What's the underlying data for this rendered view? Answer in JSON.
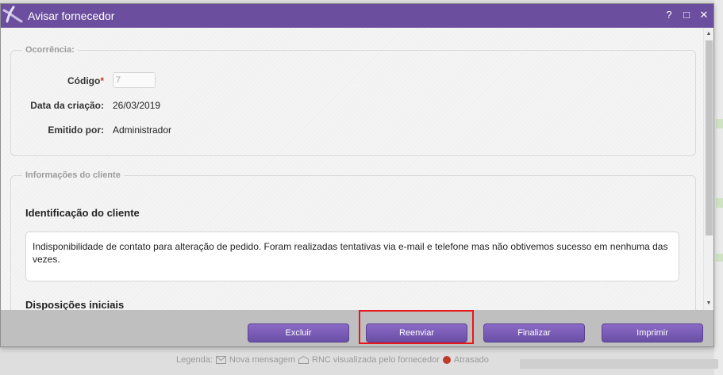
{
  "window": {
    "title": "Avisar fornecedor",
    "help": "?",
    "maximize": "□",
    "close": "✕"
  },
  "ocorrencia": {
    "legend": "Ocorrência:",
    "codigo_label": "Código",
    "required_mark": "*",
    "codigo_value": "7",
    "data_label": "Data da criação:",
    "data_value": "26/03/2019",
    "emitido_label": "Emitido por:",
    "emitido_value": "Administrador"
  },
  "cliente": {
    "legend": "Informações do cliente",
    "identificacao_title": "Identificação do cliente",
    "identificacao_text": "Indisponibilidade de contato para alteração de pedido. Foram realizadas tentativas via e-mail e telefone mas não obtivemos sucesso em nenhuma das vezes.",
    "disposicoes_title": "Disposições iniciais"
  },
  "footer": {
    "excluir": "Excluir",
    "reenviar": "Reenviar",
    "finalizar": "Finalizar",
    "imprimir": "Imprimir"
  },
  "legend_bar": {
    "label": "Legenda:",
    "nova_mensagem": "Nova mensagem",
    "rnc_visualizada": "RNC visualizada pelo fornecedor",
    "atrasado": "Atrasado"
  },
  "colors": {
    "titlebar": "#6b4f9e",
    "button": "#7a5bb8",
    "highlight": "#e8151b",
    "required": "#c0392b"
  }
}
